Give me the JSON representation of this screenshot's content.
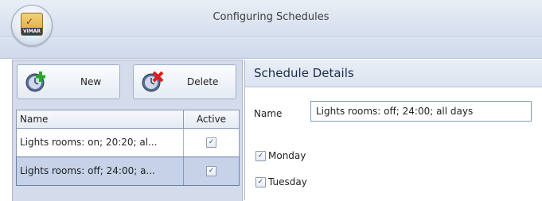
{
  "window": {
    "title": "Configuring Schedules",
    "logo_text": "VIMAR"
  },
  "toolbar": {
    "new_label": "New",
    "delete_label": "Delete"
  },
  "schedules_table": {
    "columns": [
      "Name",
      "Active"
    ],
    "rows": [
      {
        "name": "Lights rooms: on; 20:20; al...",
        "active": true,
        "selected": false
      },
      {
        "name": "Lights rooms: off; 24:00; a...",
        "active": true,
        "selected": true
      }
    ]
  },
  "details": {
    "title": "Schedule Details",
    "name_label": "Name",
    "name_value": "Lights rooms: off; 24:00; all days",
    "days": [
      {
        "label": "Monday",
        "checked": true
      },
      {
        "label": "Tuesday",
        "checked": true
      }
    ]
  },
  "colors": {
    "accent": "#1a2d4f",
    "selected_row": "#c5d2e8",
    "add_icon": "#1bb11b",
    "delete_icon": "#e01b1b"
  }
}
